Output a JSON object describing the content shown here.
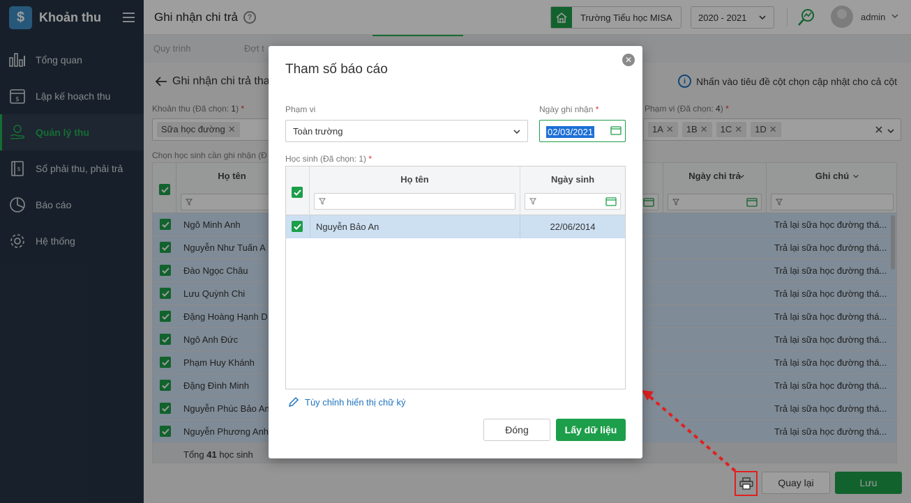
{
  "sidebar": {
    "app_title": "Khoản thu",
    "items": [
      {
        "label": "Tổng quan",
        "icon": "chart-bars-icon"
      },
      {
        "label": "Lập kế hoạch thu",
        "icon": "calendar-money-icon"
      },
      {
        "label": "Quản lý thu",
        "icon": "hand-coin-icon"
      },
      {
        "label": "Sổ phải thu, phải trả",
        "icon": "ledger-book-icon"
      },
      {
        "label": "Báo cáo",
        "icon": "pie-chart-icon"
      },
      {
        "label": "Hệ thống",
        "icon": "gear-icon"
      }
    ],
    "active_index": 2
  },
  "header": {
    "title": "Ghi nhận chi trả",
    "school": "Trường Tiểu học MISA",
    "school_year": "2020 - 2021",
    "user": "admin"
  },
  "tabs": [
    "Quy trình",
    "Đợt t"
  ],
  "page": {
    "back_title": "Ghi nhận chi trả tha",
    "info_text": "Nhấn vào tiêu đề cột chọn cập nhật cho cả cột",
    "khoan_thu_label": "Khoản thu (Đã chọn: ",
    "khoan_thu_count": "1",
    "khoan_thu_tag": "Sữa học đường",
    "pham_vi_label": "Phạm vi (Đã chọn: ",
    "pham_vi_count": "4",
    "pham_vi_tags": [
      "1A",
      "1B",
      "1C",
      "1D"
    ],
    "select_label": "Chọn học sinh cần ghi nhận (Đ"
  },
  "grid": {
    "columns": [
      "Họ tên",
      "Ngày chi trả",
      "Ghi chú"
    ],
    "rows": [
      {
        "name": "Ngô Minh Anh",
        "note": "Trả lại sữa học đường thá..."
      },
      {
        "name": "Nguyễn Như Tuấn A",
        "note": "Trả lại sữa học đường thá..."
      },
      {
        "name": "Đào Ngọc Châu",
        "note": "Trả lại sữa học đường thá..."
      },
      {
        "name": "Lưu Quỳnh Chi",
        "note": "Trả lại sữa học đường thá..."
      },
      {
        "name": "Đặng Hoàng Hạnh D",
        "note": "Trả lại sữa học đường thá..."
      },
      {
        "name": "Ngô Anh Đức",
        "note": "Trả lại sữa học đường thá..."
      },
      {
        "name": "Phạm Huy Khánh",
        "note": "Trả lại sữa học đường thá..."
      },
      {
        "name": "Đặng Đình Minh",
        "note": "Trả lại sữa học đường thá..."
      },
      {
        "name": "Nguyễn Phúc Bảo An",
        "note": "Trả lại sữa học đường thá..."
      },
      {
        "name": "Nguyễn Phương Anh",
        "note": "Trả lại sữa học đường thá..."
      }
    ],
    "total_prefix": "Tổng ",
    "total_count": "41",
    "total_suffix": " học sinh"
  },
  "footer": {
    "back_button": "Quay lại",
    "save_button": "Lưu"
  },
  "dialog": {
    "title": "Tham số báo cáo",
    "scope_label": "Phạm vi",
    "scope_value": "Toàn trường",
    "date_label": "Ngày ghi nhận ",
    "date_value": "02/03/2021",
    "students_label": "Học sinh (Đã chọn: 1) ",
    "col_name": "Họ tên",
    "col_dob": "Ngày sinh",
    "rows": [
      {
        "name": "Nguyễn Bảo An",
        "dob": "22/06/2014"
      }
    ],
    "signature_link": "Tùy chỉnh hiển thị chữ ký",
    "close_button": "Đóng",
    "get_data_button": "Lấy dữ liệu"
  },
  "colors": {
    "accent": "#1d9e4a",
    "sidebar_bg": "#263445",
    "selected_row": "#cde0f2",
    "callout": "#e02020"
  }
}
